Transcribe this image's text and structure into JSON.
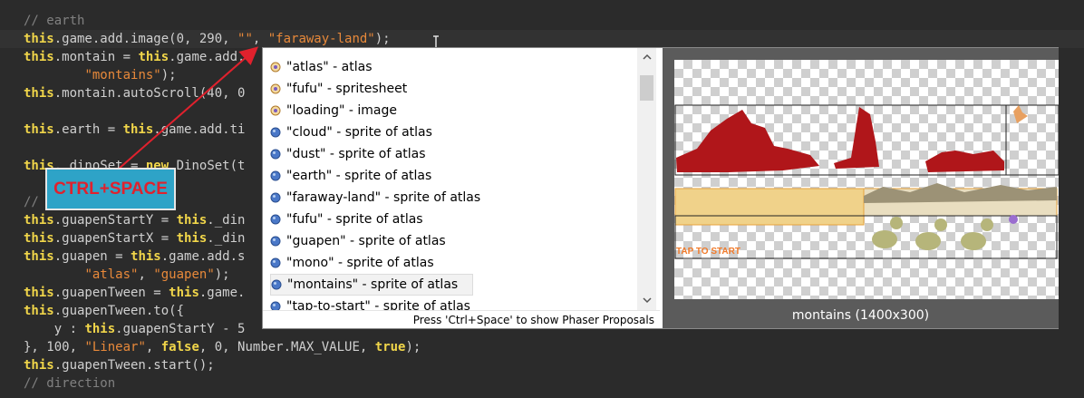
{
  "editor": {
    "lines": [
      {
        "comment": "// earth"
      },
      {
        "kw1": "this",
        "a": ".game.add.image(0, 290, ",
        "s1": "\"\"",
        "b": ", ",
        "s2": "\"faraway-land\"",
        "c": ");"
      },
      {
        "kw1": "this",
        "a": ".montain = ",
        "kw2": "this",
        "b": ".game.add."
      },
      {
        "indent": "        ",
        "s1": "\"montains\"",
        "a": ");"
      },
      {
        "kw1": "this",
        "a": ".montain.autoScroll(40, 0"
      },
      {
        "kw1": "this",
        "a": ".earth = ",
        "kw2": "this",
        "b": ".game.add.ti"
      },
      {
        "kw1": "this",
        "a": "._dinoSet = ",
        "kw2": "new",
        "b": " DinoSet(t"
      },
      {
        "comment": "//"
      },
      {
        "kw1": "this",
        "a": ".guapenStartY = ",
        "kw2": "this",
        "b": "._din"
      },
      {
        "kw1": "this",
        "a": ".guapenStartX = ",
        "kw2": "this",
        "b": "._din"
      },
      {
        "kw1": "this",
        "a": ".guapen = ",
        "kw2": "this",
        "b": ".game.add.s"
      },
      {
        "indent": "        ",
        "s1": "\"atlas\"",
        "a": ", ",
        "s2": "\"guapen\"",
        "b": ");"
      },
      {
        "kw1": "this",
        "a": ".guapenTween = ",
        "kw2": "this",
        "b": ".game."
      },
      {
        "kw1": "this",
        "a": ".guapenTween.to({"
      },
      {
        "indent": "    ",
        "a": "y : ",
        "kw1": "this",
        "b": ".guapenStartY - 5"
      },
      {
        "a": "}, 100, ",
        "s1": "\"Linear\"",
        "b": ", ",
        "kw1": "false",
        "c": ", 0, Number.MAX_VALUE, ",
        "kw2": "true",
        "d": ");"
      },
      {
        "kw1": "this",
        "a": ".guapenTween.start();"
      },
      {
        "comment": "// direction"
      }
    ]
  },
  "annotation": {
    "label": "CTRL+SPACE"
  },
  "proposals": {
    "items": [
      {
        "label": "\"atlas\" - atlas",
        "icon": "asset-pack-icon"
      },
      {
        "label": "\"fufu\" - spritesheet",
        "icon": "asset-pack-icon"
      },
      {
        "label": "\"loading\" - image",
        "icon": "asset-pack-icon"
      },
      {
        "label": "\"cloud\" - sprite of atlas",
        "icon": "sprite-frame-icon"
      },
      {
        "label": "\"dust\" - sprite of atlas",
        "icon": "sprite-frame-icon"
      },
      {
        "label": "\"earth\" - sprite of atlas",
        "icon": "sprite-frame-icon"
      },
      {
        "label": "\"faraway-land\" - sprite of atlas",
        "icon": "sprite-frame-icon"
      },
      {
        "label": "\"fufu\" - sprite of atlas",
        "icon": "sprite-frame-icon"
      },
      {
        "label": "\"guapen\" - sprite of atlas",
        "icon": "sprite-frame-icon"
      },
      {
        "label": "\"mono\" - sprite of atlas",
        "icon": "sprite-frame-icon"
      },
      {
        "label": "\"montains\" - sprite of atlas",
        "icon": "sprite-frame-icon",
        "selected": true
      },
      {
        "label": "\"tap-to-start\" - sprite of atlas",
        "icon": "sprite-frame-icon"
      }
    ],
    "status": "Press 'Ctrl+Space' to show Phaser Proposals"
  },
  "preview": {
    "caption": "montains (1400x300)",
    "sprite_text": "TAP TO START"
  },
  "colors": {
    "editor_bg": "#2b2b2b",
    "keyword": "#f1d64a",
    "string": "#e8893a",
    "comment": "#808080",
    "annotation_bg": "#2ea3c7",
    "annotation_text": "#e0212d",
    "arrow": "#e0212d"
  }
}
